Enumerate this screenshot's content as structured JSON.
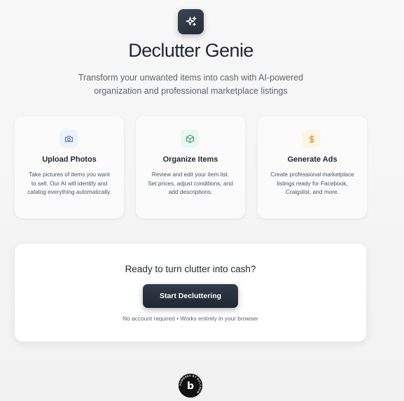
{
  "app": {
    "title": "Declutter Genie",
    "subtitle": "Transform your unwanted items into cash with AI-powered organization and professional marketplace listings",
    "logo_icon": "sparkles-icon"
  },
  "features": [
    {
      "icon": "camera-icon",
      "icon_color": "#4a6fd8",
      "icon_bg": "#eef2fd",
      "heading": "Upload Photos",
      "description": "Take pictures of items you want to sell. Our AI will identify and catalog everything automatically."
    },
    {
      "icon": "box-icon",
      "icon_color": "#2f9e6e",
      "icon_bg": "#eaf7f0",
      "heading": "Organize Items",
      "description": "Review and edit your item list. Set prices, adjust conditions, and add descriptions."
    },
    {
      "icon": "dollar-icon",
      "icon_color": "#d18a1c",
      "icon_bg": "#fdf5e6",
      "heading": "Generate Ads",
      "description": "Create professional marketplace listings ready for Facebook, Craigslist, and more."
    }
  ],
  "cta": {
    "heading": "Ready to turn clutter into cash?",
    "button_label": "Start Decluttering",
    "note": "No account required • Works entirely in your browser"
  },
  "footer": {
    "badge_icon": "bolt-badge-icon",
    "badge_text": "POWERED BY BOLT.NEW"
  },
  "colors": {
    "accent_dark": "#252c38",
    "background": "#f5f5f5"
  }
}
